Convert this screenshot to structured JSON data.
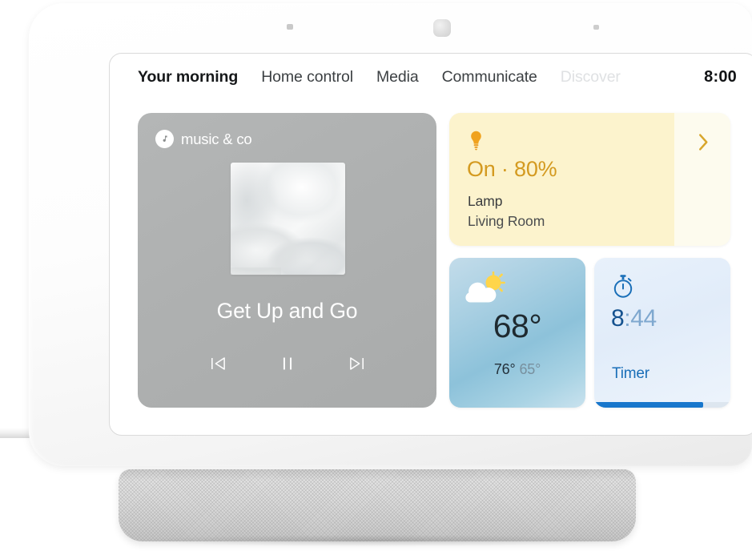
{
  "device": {
    "name": "smart-display",
    "sensors": [
      "sensor-dot-left",
      "ambient-light-sensor",
      "sensor-dot-right"
    ],
    "base_label": "speaker-base"
  },
  "nav": {
    "items": [
      {
        "label": "Your morning",
        "state": "active"
      },
      {
        "label": "Home control",
        "state": "normal"
      },
      {
        "label": "Media",
        "state": "normal"
      },
      {
        "label": "Communicate",
        "state": "normal"
      },
      {
        "label": "Discover",
        "state": "faded"
      }
    ],
    "clock": "8:00"
  },
  "music_card": {
    "provider": "music & co",
    "provider_icon": "music-note-icon",
    "track_title": "Get Up and Go",
    "album_art": "abstract-light-album-art",
    "controls": [
      {
        "name": "previous-track-button",
        "icon": "skip-previous-icon"
      },
      {
        "name": "pause-button",
        "icon": "pause-icon"
      },
      {
        "name": "next-track-button",
        "icon": "skip-next-icon"
      }
    ],
    "background_color": "#afb1b1"
  },
  "lamp_card": {
    "icon": "lightbulb-icon",
    "state_text": "On · 80%",
    "brightness_percent": 80,
    "device_name": "Lamp",
    "room": "Living Room",
    "chevron_icon": "chevron-right-icon",
    "accent_color": "#d49a20",
    "fill_color": "#fcf3cd",
    "background_color": "#fdfbee"
  },
  "weather_card": {
    "condition_icon": "partly-cloudy-icon",
    "current_temp": "68°",
    "high_temp": "76°",
    "low_temp": "65°",
    "background_color": "#8dc2da"
  },
  "timer_card": {
    "icon": "stopwatch-icon",
    "minutes": "8",
    "seconds": ":44",
    "label": "Timer",
    "progress_percent": 80,
    "accent_color": "#1877cc",
    "background_color": "#e4eefb"
  }
}
